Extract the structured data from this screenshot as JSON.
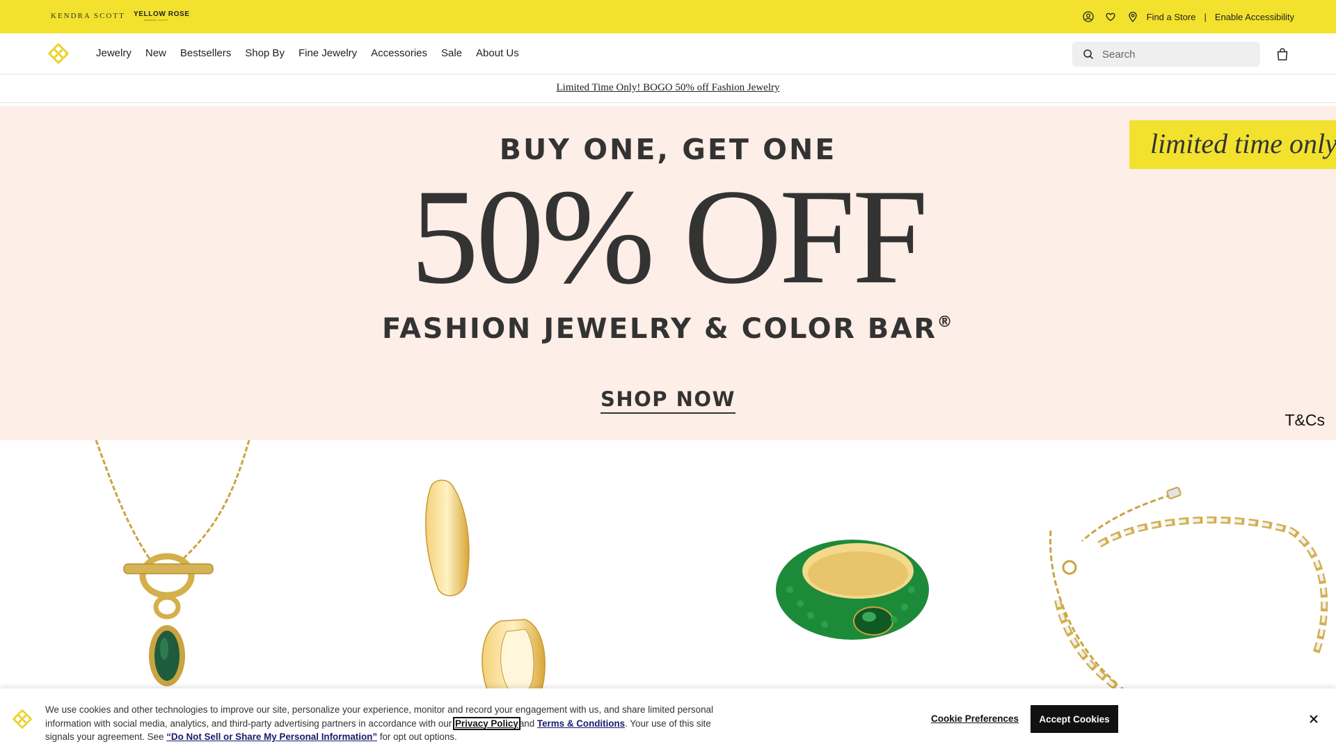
{
  "utility_bar": {
    "brand_primary": "KENDRA SCOTT",
    "brand_secondary": "YELLOW ROSE",
    "brand_secondary_sub": "KENDRA SCOTT",
    "icons": [
      "account-icon",
      "heart-icon",
      "location-pin-icon"
    ],
    "find_store": "Find a Store",
    "separator": "|",
    "accessibility": "Enable Accessibility",
    "background_color": "#f2e22e"
  },
  "nav": {
    "items": [
      "Jewelry",
      "New",
      "Bestsellers",
      "Shop By",
      "Fine Jewelry",
      "Accessories",
      "Sale",
      "About Us"
    ],
    "search_placeholder": "Search",
    "logo_color": "#f2e22e"
  },
  "promo": {
    "text": "Limited Time Only! BOGO 50% off Fashion Jewelry"
  },
  "hero": {
    "headline_top": "BUY ONE, GET ONE",
    "headline_big": "50% OFF",
    "headline_sub": "FASHION JEWELRY & COLOR BAR",
    "headline_sub_mark": "®",
    "cta": "SHOP NOW",
    "badge": "limited time only!",
    "terms": "T&Cs",
    "background_color": "#fdeee7"
  },
  "products": [
    {
      "name": "toggle-necklace-image",
      "color": "green malachite stone"
    },
    {
      "name": "gold-huggie-earrings-image",
      "color": "gold"
    },
    {
      "name": "pave-ring-image",
      "color": "emerald green"
    },
    {
      "name": "baguette-tennis-bracelet-image",
      "color": "gold"
    }
  ],
  "cookie_banner": {
    "text_1": "We use cookies and other technologies to improve our site, personalize your experience, monitor and record your engagement with us, and share limited personal information with social media, analytics, and third-party advertising partners in accordance with our",
    "privacy_link": "Privacy Policy",
    "text_and": "and",
    "terms_link": "Terms & Conditions",
    "text_2": ". Your use of this site signals your agreement. See",
    "dns_link": "“Do Not Sell or Share My Personal Information”",
    "text_3": "for opt out options.",
    "preferences": "Cookie Preferences",
    "accept": "Accept Cookies"
  }
}
